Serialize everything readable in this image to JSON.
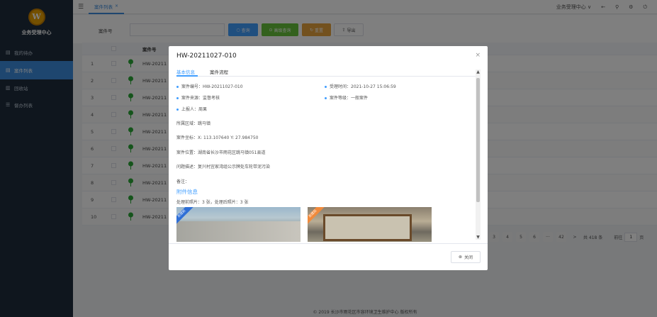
{
  "app": {
    "title": "业务受理中心",
    "logo_letter": "W"
  },
  "sidebar": {
    "items": [
      {
        "label": "我的待办",
        "icon": "file-icon"
      },
      {
        "label": "案件列表",
        "icon": "file-icon",
        "active": true
      },
      {
        "label": "回收站",
        "icon": "trash-icon"
      },
      {
        "label": "督办列表",
        "icon": "list-icon"
      }
    ]
  },
  "topbar": {
    "tab_label": "案件列表",
    "org_select": "业务受理中心 ∨"
  },
  "search": {
    "label": "案件号",
    "placeholder": "",
    "btn_search": "查询",
    "btn_advanced": "高级查询",
    "btn_reset": "重置",
    "btn_export": "导出"
  },
  "table": {
    "header_code": "案件号",
    "rows": [
      {
        "idx": "1",
        "code": "HW-20211027-010"
      },
      {
        "idx": "2",
        "code": "HW-20211027-009"
      },
      {
        "idx": "3",
        "code": "HW-20211027-008"
      },
      {
        "idx": "4",
        "code": "HW-20211027-007"
      },
      {
        "idx": "5",
        "code": "HW-20211027-006"
      },
      {
        "idx": "6",
        "code": "HW-20211027-005"
      },
      {
        "idx": "7",
        "code": "HW-20211027-004"
      },
      {
        "idx": "8",
        "code": "HW-20211027-003"
      },
      {
        "idx": "9",
        "code": "HW-20211027-002"
      },
      {
        "idx": "10",
        "code": "HW-20211027-001"
      }
    ],
    "row_code_visible": "HW-20211"
  },
  "pager": {
    "pages": [
      "3",
      "4",
      "5",
      "6",
      "···",
      "42"
    ],
    "next": ">",
    "total": "共 418 条",
    "goto_prefix": "前往",
    "goto_value": "1",
    "goto_suffix": "页"
  },
  "footer": {
    "text": "© 2019 长沙市雨花区市容环境卫生维护中心 版权所有"
  },
  "modal": {
    "title": "HW-20211027-010",
    "tabs": [
      "基本信息",
      "案件流程"
    ],
    "info": {
      "case_no": "案件编号：HW-20211027-010",
      "accept_time": "受理时间：2021-10-27 15:06:59",
      "source": "案件来源：监督考核",
      "level": "案件等级：一般案件",
      "reporter": "上报人：周果"
    },
    "region": "所属区域：跳马镇",
    "coords": "案件坐标：X: 113.107640 Y: 27.984750",
    "location": "案件位置：湖南省长沙市雨花区跳马镇051县道",
    "description": "问题描述：复兴村宜家湾组公示牌处车轮带泥污染",
    "remark": "备注：",
    "attach_title": "附件信息",
    "attach_sub": "处理前照片：3 张，处理后照片：3 张",
    "ribbon_before": "处理前",
    "ribbon_after": "处理后",
    "close_label": "关闭"
  },
  "colors": {
    "accent": "#409eff",
    "sidebar_bg": "#1f2d3d",
    "logo": "#e8a000",
    "pin": "#2aa836"
  }
}
